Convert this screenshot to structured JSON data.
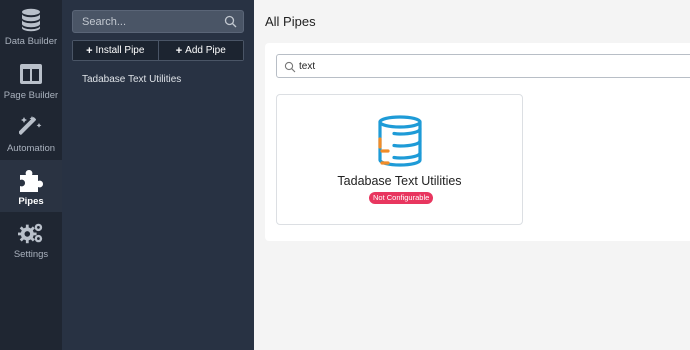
{
  "rail": {
    "items": [
      {
        "label": "Data Builder",
        "icon": "database-icon"
      },
      {
        "label": "Page Builder",
        "icon": "layout-icon"
      },
      {
        "label": "Automation",
        "icon": "magic-wand-icon"
      },
      {
        "label": "Pipes",
        "icon": "puzzle-icon",
        "active": true
      },
      {
        "label": "Settings",
        "icon": "gears-icon"
      }
    ]
  },
  "sidebar": {
    "search_placeholder": "Search...",
    "install_label": "Install Pipe",
    "add_label": "Add Pipe",
    "plus": "+",
    "items": [
      "Tadabase Text Utilities"
    ]
  },
  "main": {
    "title": "All Pipes",
    "filter_value": "text",
    "cards": [
      {
        "name": "Tadabase Text Utilities",
        "badge": "Not Configurable",
        "icon": "database-logo-icon"
      }
    ]
  },
  "colors": {
    "rail_bg": "#1f2632",
    "sidebar_bg": "#283243",
    "badge": "#e8365f",
    "logo_blue": "#1e9bd7",
    "logo_orange": "#f28c28"
  }
}
